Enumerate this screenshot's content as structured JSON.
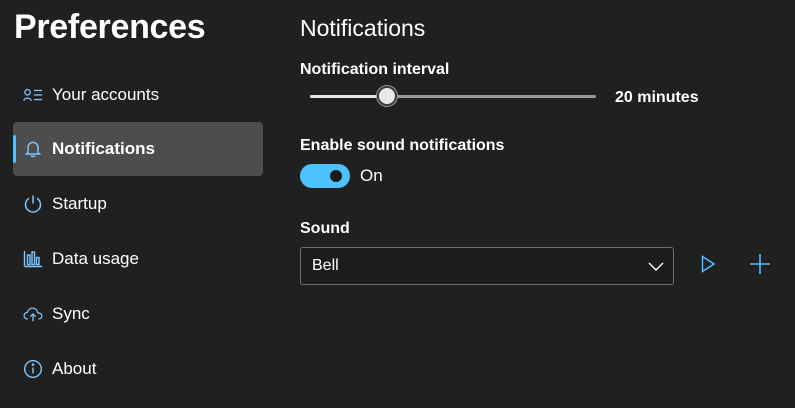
{
  "app": {
    "title": "Preferences"
  },
  "sidebar": {
    "items": [
      {
        "label": "Your accounts",
        "icon": "accounts-icon",
        "selected": false
      },
      {
        "label": "Notifications",
        "icon": "bell-icon",
        "selected": true
      },
      {
        "label": "Startup",
        "icon": "power-icon",
        "selected": false
      },
      {
        "label": "Data usage",
        "icon": "bar-chart-icon",
        "selected": false
      },
      {
        "label": "Sync",
        "icon": "cloud-sync-icon",
        "selected": false
      },
      {
        "label": "About",
        "icon": "info-icon",
        "selected": false
      }
    ]
  },
  "main": {
    "section_title": "Notifications",
    "interval": {
      "label": "Notification interval",
      "value_text": "20 minutes",
      "fraction": 0.27
    },
    "sound_notifications": {
      "label": "Enable sound notifications",
      "state_text": "On",
      "enabled": true
    },
    "sound": {
      "label": "Sound",
      "selected": "Bell"
    }
  },
  "colors": {
    "background": "#202020",
    "accent": "#4cc2ff",
    "selected_item": "#4d4d4d"
  }
}
